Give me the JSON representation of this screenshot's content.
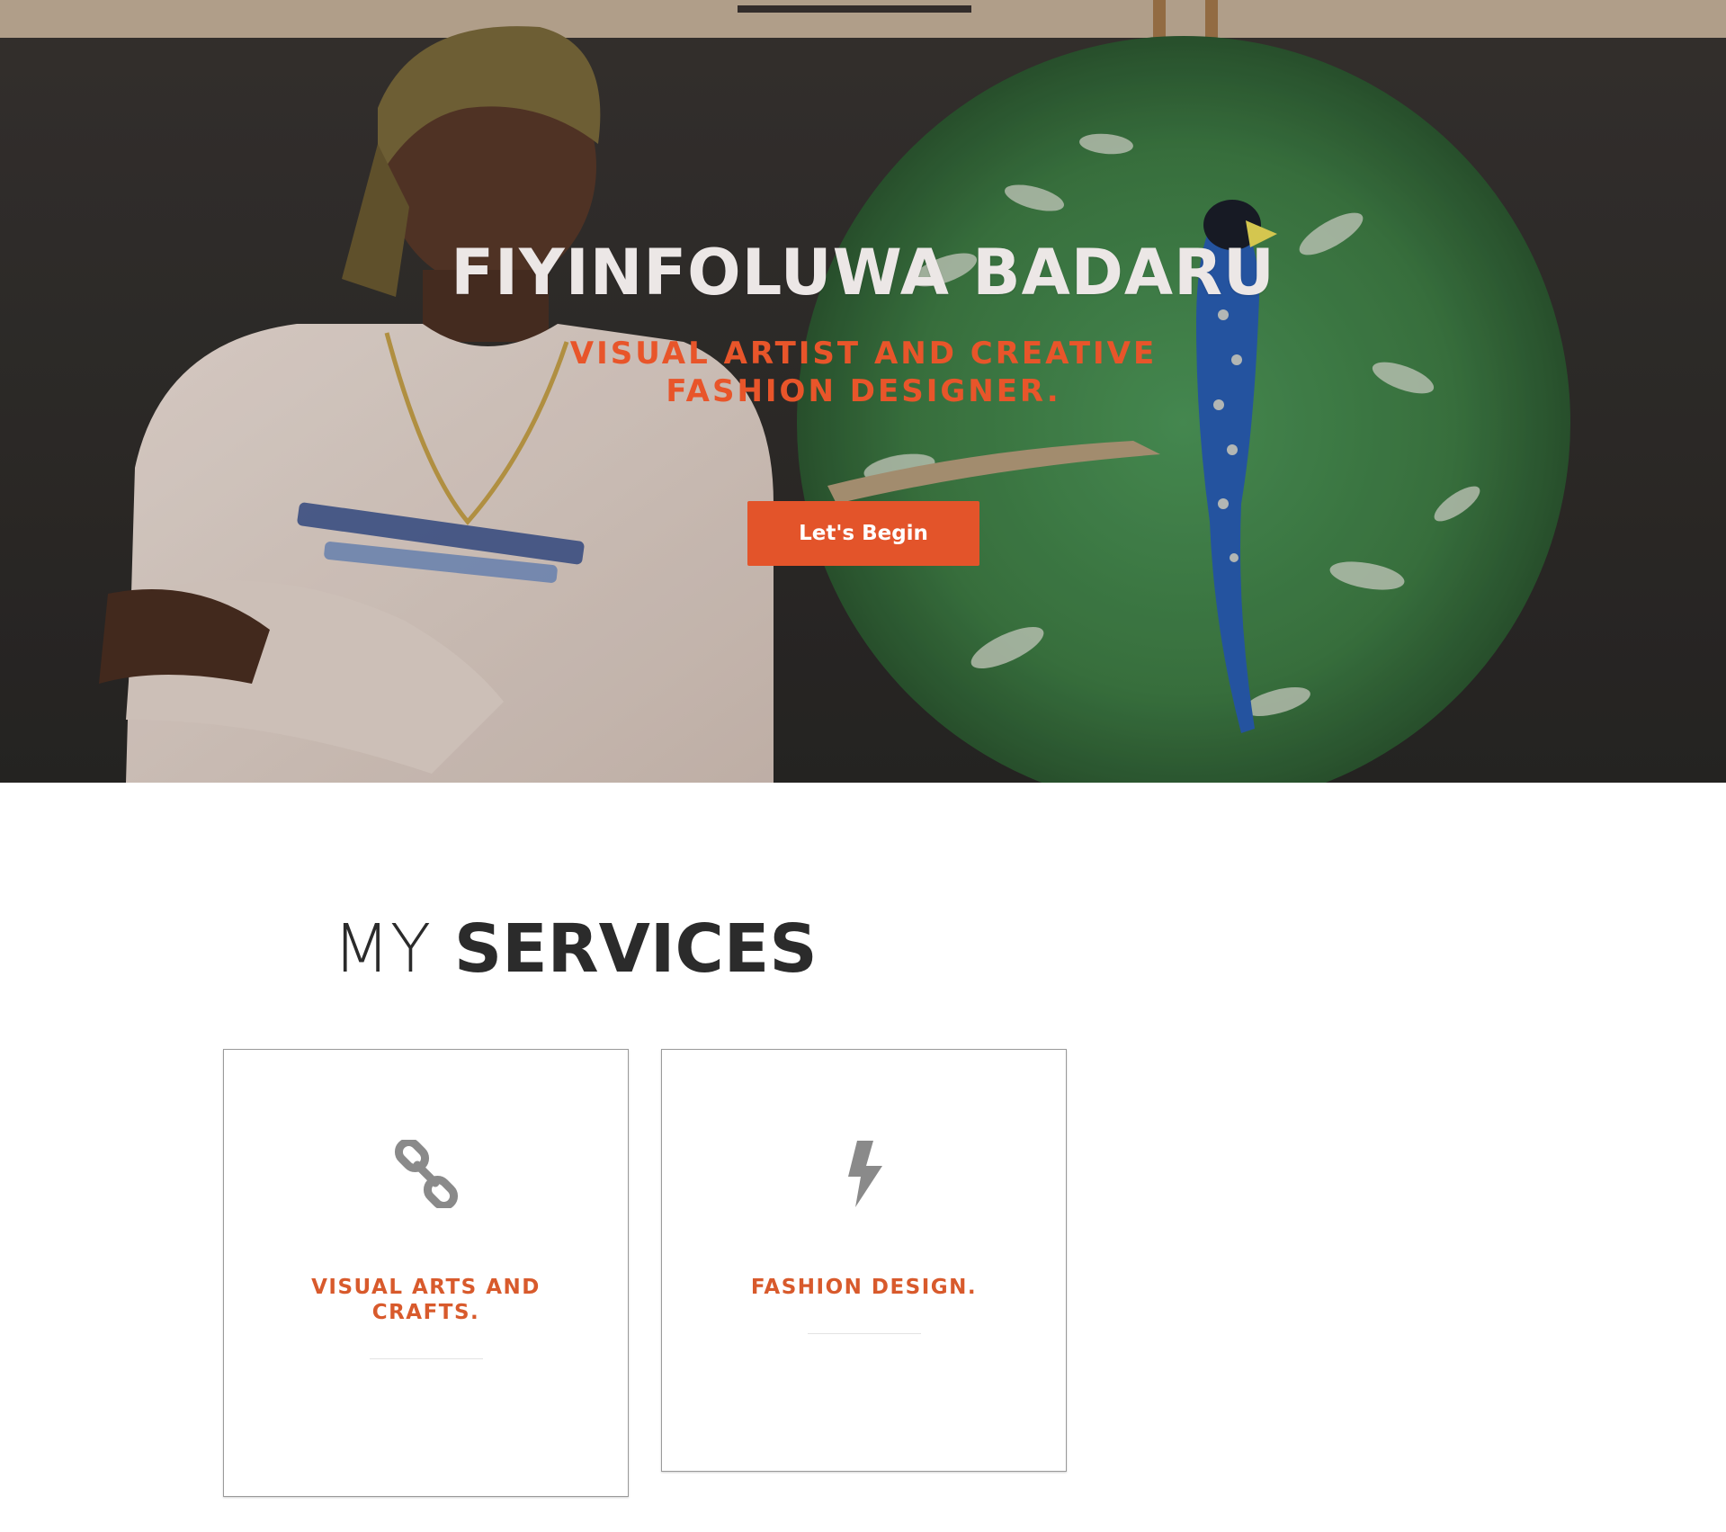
{
  "hero": {
    "title": "FIYINFOLUWA BADARU",
    "subtitle": "VISUAL ARTIST AND CREATIVE FASHION DESIGNER.",
    "button_label": "Let's Begin",
    "accent_color": "#e3542a"
  },
  "services": {
    "heading_light": "MY",
    "heading_bold": "SERVICES",
    "cards": [
      {
        "icon": "link-icon",
        "title": "VISUAL ARTS AND CRAFTS."
      },
      {
        "icon": "lightning-bolt-icon",
        "title": "FASHION DESIGN."
      }
    ]
  }
}
